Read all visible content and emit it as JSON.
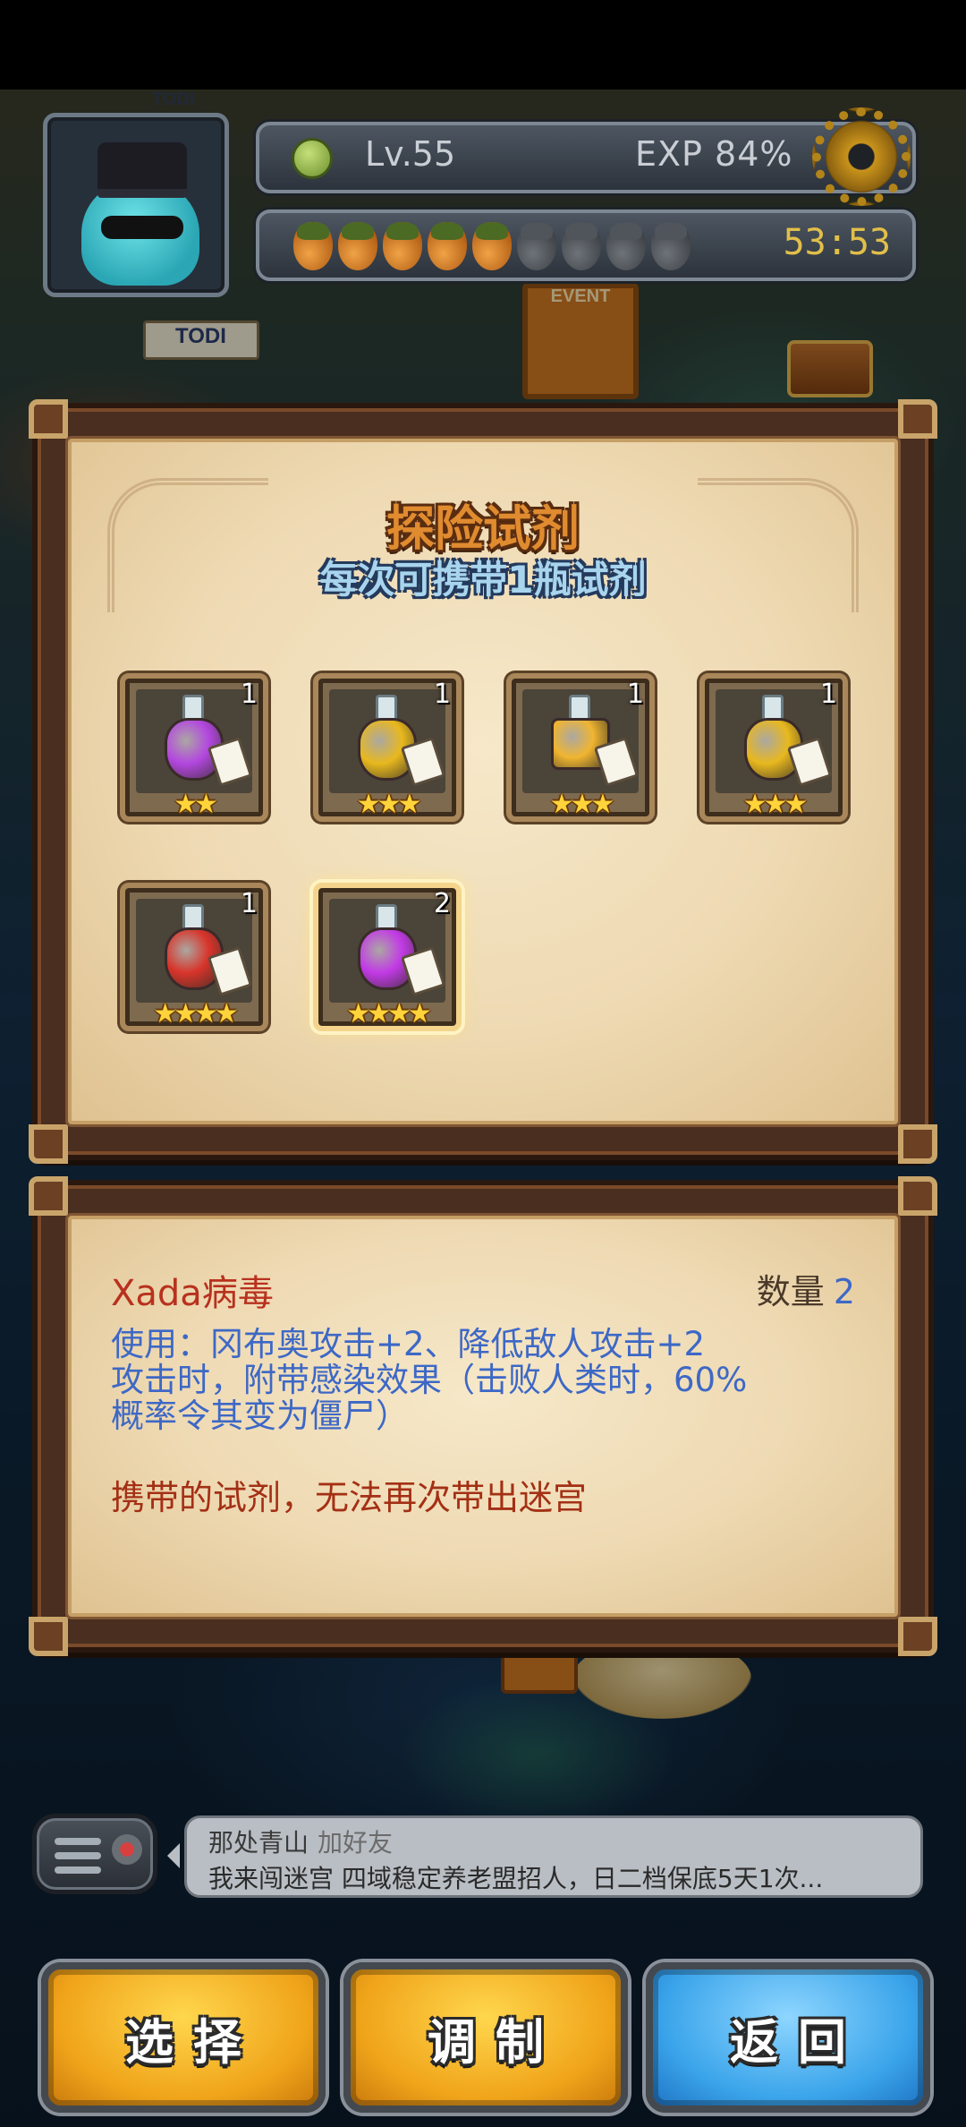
{
  "hud": {
    "level": "Lv.55",
    "exp": "EXP  84%",
    "stamina_total": 9,
    "stamina_filled": 5,
    "timer": "53:53",
    "settings_icon": "gear-icon",
    "level_icon": "leaf-icon"
  },
  "map": {
    "event_label": "EVENT",
    "todi_label": "TODI",
    "todi_label_top": "TODI"
  },
  "panel": {
    "title": "探险试剂",
    "subtitle": "每次可携带1瓶试剂",
    "items": [
      {
        "count": "1",
        "stars": "★★",
        "icon": "purple-potion-icon",
        "color": "#b347e0",
        "tag": "#f7f4ea"
      },
      {
        "count": "1",
        "stars": "★★★",
        "icon": "gold-potion-icon",
        "color": "#e8b81e",
        "tag": "#f7f4ea"
      },
      {
        "count": "1",
        "stars": "★★★",
        "icon": "gold-flask-icon",
        "color": "#f0b530",
        "tag": "#f7f4ea"
      },
      {
        "count": "1",
        "stars": "★★★",
        "icon": "gold-potion-icon",
        "color": "#e8b81e",
        "tag": "#f7f4ea"
      },
      {
        "count": "1",
        "stars": "★★★★",
        "icon": "red-potion-icon",
        "color": "#d8342a",
        "tag": "#f7f4ea"
      },
      {
        "count": "2",
        "stars": "★★★★",
        "icon": "purple-potion-icon",
        "color": "#c23ae6",
        "tag": "#f7f4ea"
      }
    ],
    "selected_index": 5
  },
  "detail": {
    "name": "Xada病毒",
    "qty_label": "数量",
    "qty_value": "2",
    "desc_line1": "使用：冈布奥攻击+2、降低敌人攻击+2",
    "desc_line2": "攻击时，附带感染效果（击败人类时，60%",
    "desc_line3": "概率令其变为僵尸）",
    "warning": "携带的试剂，无法再次带出迷宫"
  },
  "chat": {
    "sender": "那处青山",
    "add_friend": "加好友",
    "message": "我来闯迷宫 四域稳定养老盟招人，日二档保底5天1次..."
  },
  "buttons": {
    "select": "选择",
    "craft": "调制",
    "back": "返回"
  }
}
